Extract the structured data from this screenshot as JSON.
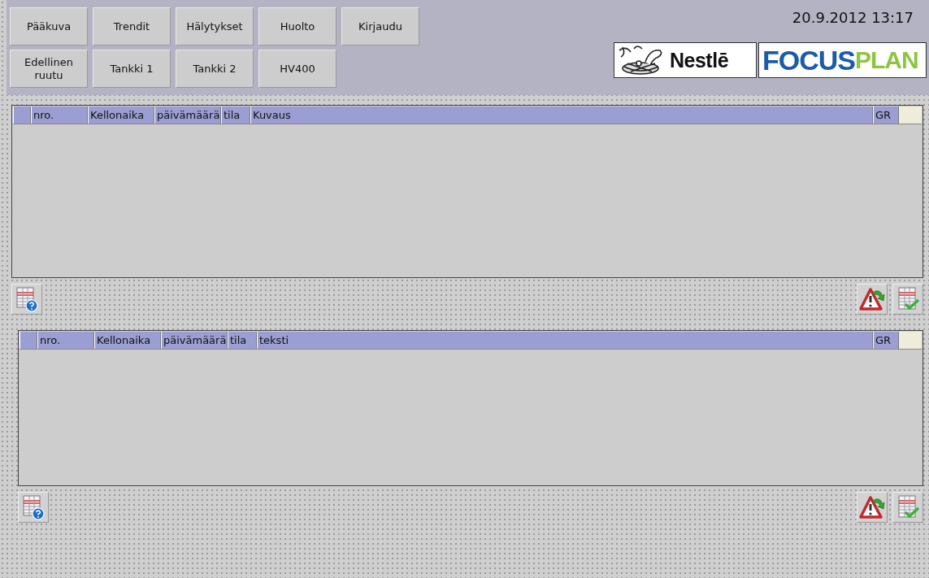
{
  "nav_rows": [
    [
      "Pääkuva",
      "Trendit",
      "Hälytykset",
      "Huolto",
      "Kirjaudu"
    ],
    [
      "Edellinen ruutu",
      "Tankki 1",
      "Tankki 2",
      "HV400"
    ]
  ],
  "datetime": "20.9.2012 13:17",
  "logos": {
    "nestle": "Nestlē",
    "focus": "FOCUS",
    "plan": "PLAN"
  },
  "tables": [
    {
      "columns": [
        "nro.",
        "Kellonaika",
        "päivämäärä",
        "tila",
        "Kuvaus",
        "GR"
      ]
    },
    {
      "columns": [
        "nro.",
        "Kellonaika",
        "päivämäärä",
        "tila",
        "teksti",
        "GR"
      ]
    }
  ]
}
